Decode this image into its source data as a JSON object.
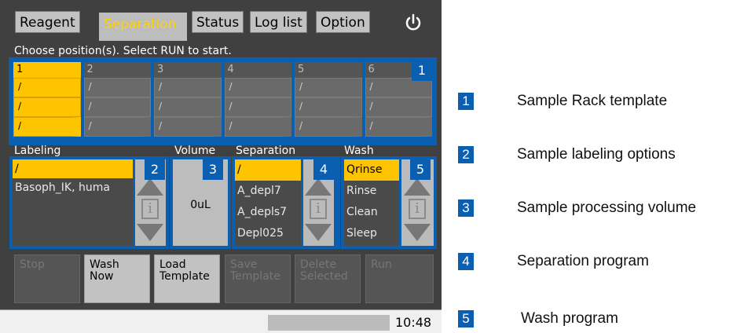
{
  "tabs": [
    {
      "label": "Reagent",
      "active": false
    },
    {
      "label": "Separation",
      "active": true
    },
    {
      "label": "Status",
      "active": false
    },
    {
      "label": "Log list",
      "active": false
    },
    {
      "label": "Option",
      "active": false
    }
  ],
  "power_icon": "power-icon",
  "instruction": "Choose position(s). Select RUN to start.",
  "rack": {
    "callout": "1",
    "columns": [
      {
        "label": "1",
        "selected": true
      },
      {
        "label": "2",
        "selected": false
      },
      {
        "label": "3",
        "selected": false
      },
      {
        "label": "4",
        "selected": false
      },
      {
        "label": "5",
        "selected": false
      },
      {
        "label": "6",
        "selected": false
      }
    ],
    "cell_text": "/"
  },
  "sections": {
    "labeling": "Labeling",
    "volume": "Volume",
    "separation": "Separation",
    "wash": "Wash"
  },
  "labeling_panel": {
    "callout": "2",
    "items": [
      "/",
      "Basoph_IK, huma"
    ],
    "selected_index": 0
  },
  "volume_panel": {
    "callout": "3",
    "value": "0uL"
  },
  "separation_panel": {
    "callout": "4",
    "items": [
      "/",
      "A_depl7",
      "A_depls7",
      "Depl025"
    ],
    "selected_index": 0
  },
  "wash_panel": {
    "callout": "5",
    "items": [
      "Qrinse",
      "Rinse",
      "Clean",
      "Sleep"
    ],
    "selected_index": 0
  },
  "info_icon_glyph": "i",
  "buttons": [
    {
      "name": "stop-button",
      "line1": "Stop",
      "line2": "",
      "enabled": false
    },
    {
      "name": "wash-now-button",
      "line1": "Wash",
      "line2": "Now",
      "enabled": true
    },
    {
      "name": "load-template-button",
      "line1": "Load",
      "line2": "Template",
      "enabled": true
    },
    {
      "name": "save-template-button",
      "line1": "Save",
      "line2": "Template",
      "enabled": false
    },
    {
      "name": "delete-selected-button",
      "line1": "Delete",
      "line2": "Selected",
      "enabled": false
    },
    {
      "name": "run-button",
      "line1": "Run",
      "line2": "",
      "enabled": false
    }
  ],
  "clock": "10:48",
  "legend": [
    {
      "num": "1",
      "text": "Sample Rack template"
    },
    {
      "num": "2",
      "text": "Sample labeling options"
    },
    {
      "num": "3",
      "text": "Sample processing volume"
    },
    {
      "num": "4",
      "text": "Separation program"
    },
    {
      "num": "5",
      "text": "Wash program"
    }
  ],
  "colors": {
    "accent_yellow": "#ffc400",
    "callout_blue": "#0a5fb0",
    "screen_bg": "#404040"
  }
}
